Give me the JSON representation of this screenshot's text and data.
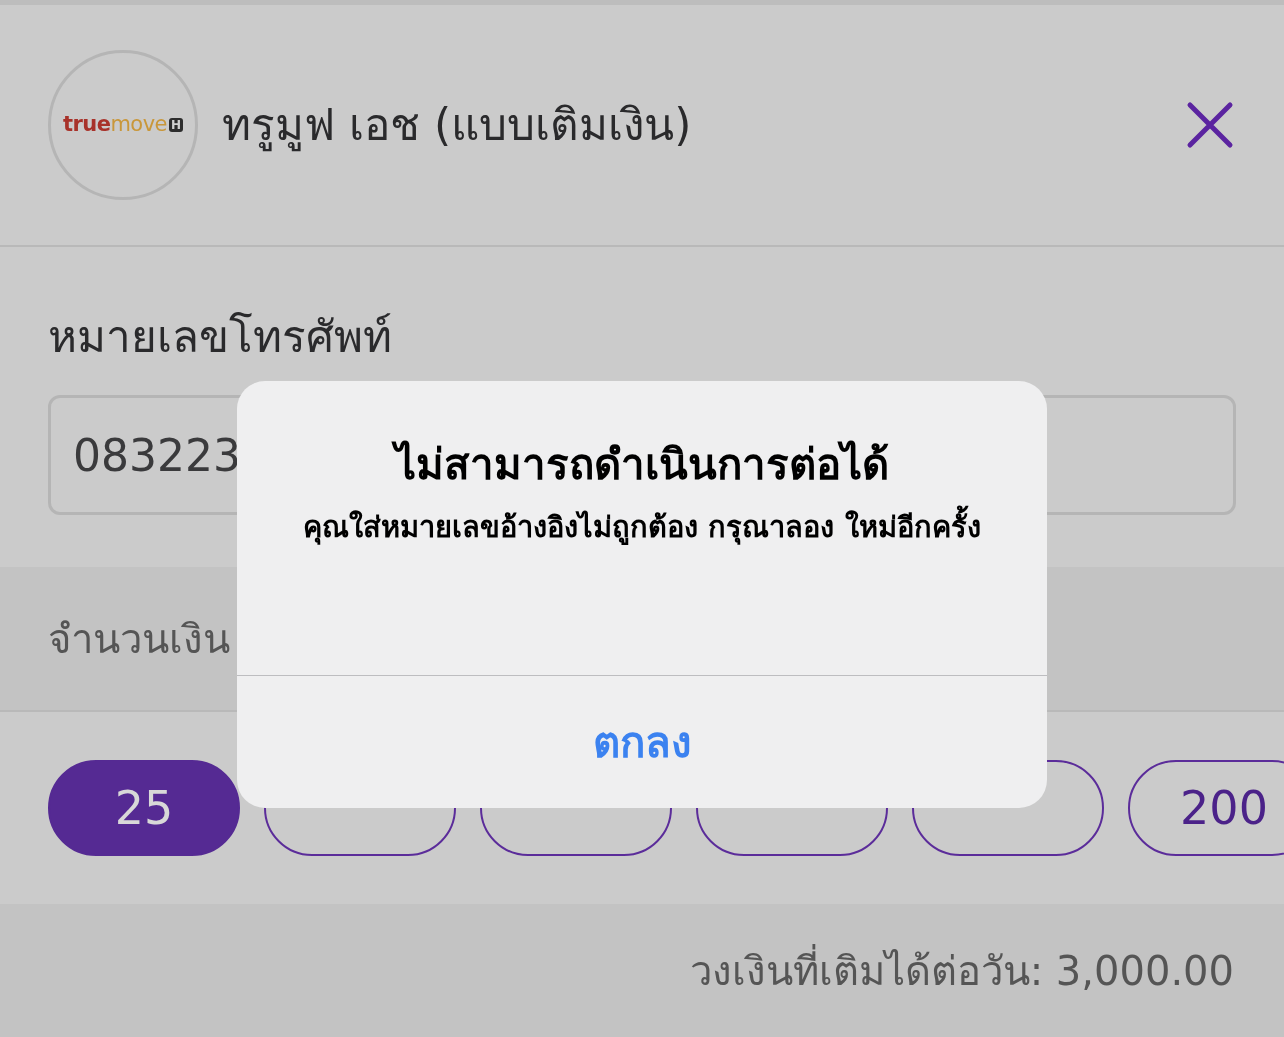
{
  "header": {
    "logo": {
      "word1": "true",
      "word2": "move",
      "badge": "H"
    },
    "title": "ทรูมูฟ เอช (แบบเติมเงิน)"
  },
  "phone": {
    "label": "หมายเลขโทรศัพท์",
    "value": "083223"
  },
  "amount": {
    "label": "จำนวนเงิน",
    "options": [
      {
        "label": "25",
        "selected": true
      },
      {
        "selected": false
      },
      {
        "selected": false
      },
      {
        "selected": false
      },
      {
        "selected": false
      },
      {
        "label": "200",
        "selected": false
      }
    ]
  },
  "daily_limit": "วงเงินที่เติมได้ต่อวัน: 3,000.00",
  "alert": {
    "title": "ไม่สามารถดำเนินการต่อได้",
    "message": "คุณใส่หมายเลขอ้างอิงไม่ถูกต้อง กรุณาลอง ใหม่อีกครั้ง",
    "button": "ตกลง"
  }
}
